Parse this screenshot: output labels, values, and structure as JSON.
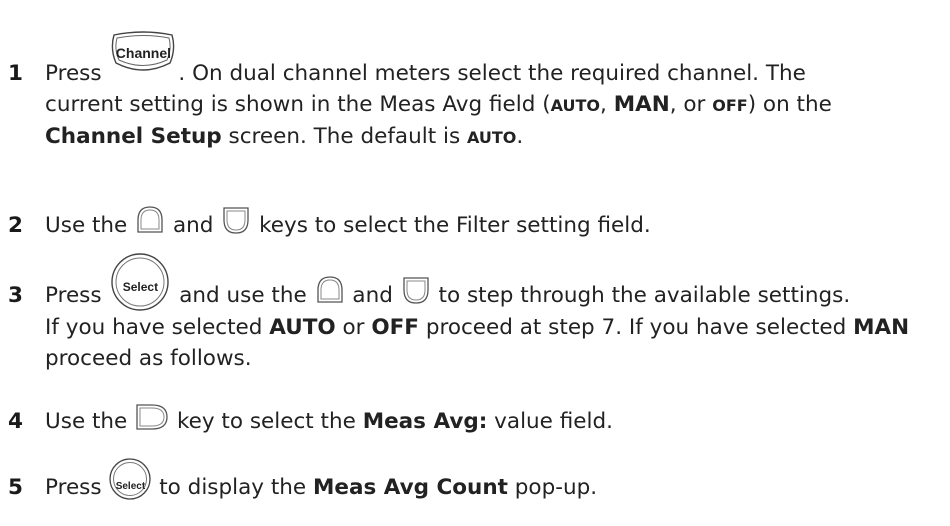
{
  "steps": [
    {
      "number": "1",
      "line1_before": "Press ",
      "key_label": "Channel",
      "line1_after": ". On dual channel meters select the required channel. The",
      "line2_a": "current setting is shown in the Meas Avg field (",
      "line2_auto": "AUTO",
      "line2_sep1": ", ",
      "line2_man": "MAN",
      "line2_sep2": ", or ",
      "line2_off": "OFF",
      "line2_b": ") on the",
      "line3_bold": "Channel Setup",
      "line3_a": " screen. The default is ",
      "line3_auto": "AUTO",
      "line3_end": "."
    },
    {
      "number": "2",
      "text_a": "Use the ",
      "text_b": " and ",
      "text_c": " keys to select the Filter setting field."
    },
    {
      "number": "3",
      "line1_a": "Press ",
      "key_label": "Select",
      "line1_b": " and use the ",
      "line1_c": " and ",
      "line1_d": " to step through the available settings.",
      "line2_a": "If you have selected ",
      "line2_auto": "AUTO",
      "line2_b": " or ",
      "line2_off": "OFF",
      "line2_c": " proceed at step 7. If you have selected ",
      "line2_man": "MAN",
      "line3": "proceed as follows."
    },
    {
      "number": "4",
      "text_a": "Use the ",
      "text_b": " key to select the ",
      "bold": "Meas Avg:",
      "text_c": " value field."
    },
    {
      "number": "5",
      "text_a": "Press ",
      "key_label": "Select",
      "text_b": " to display the ",
      "bold": "Meas Avg Count",
      "text_c": " pop-up."
    }
  ],
  "icons": {
    "channel_key": "channel-key-icon",
    "select_key": "select-key-icon",
    "up_key": "up-arrow-key-icon",
    "down_key": "down-arrow-key-icon",
    "right_key": "right-arrow-key-icon"
  }
}
